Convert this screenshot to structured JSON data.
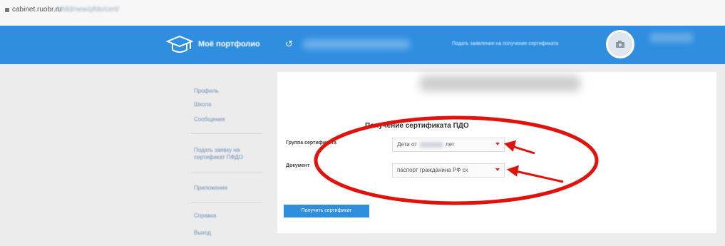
{
  "browser": {
    "url_host": "cabinet.ruobr.ru",
    "url_path": "/child/new/pfdo/cert/"
  },
  "header": {
    "app_title": "Моё портфолио",
    "refresh_icon": "refresh-icon",
    "request_link": "Подать заявление на получение сертификата",
    "avatar_icon": "camera-icon",
    "brand_color": "#2f8ee0"
  },
  "sidebar": {
    "items": [
      {
        "label": "Профиль"
      },
      {
        "label": "Школа"
      },
      {
        "label": "Сообщения"
      },
      {
        "label": "Подать заявку на сертификат ПФДО"
      },
      {
        "label": "Приложения"
      },
      {
        "label": "Справка"
      },
      {
        "label": "Выход"
      }
    ]
  },
  "form": {
    "title": "Получение сертификата ПДО",
    "group_label": "Группа сертификата",
    "group_value_prefix": "Дети от",
    "group_value_suffix": "лет",
    "document_label": "Документ",
    "document_value": "паспорт гражданина РФ сх",
    "submit_label": "Получить сертификат"
  },
  "annotations": {
    "ellipse_color": "#e0120b",
    "arrow_color": "#e0120b"
  }
}
